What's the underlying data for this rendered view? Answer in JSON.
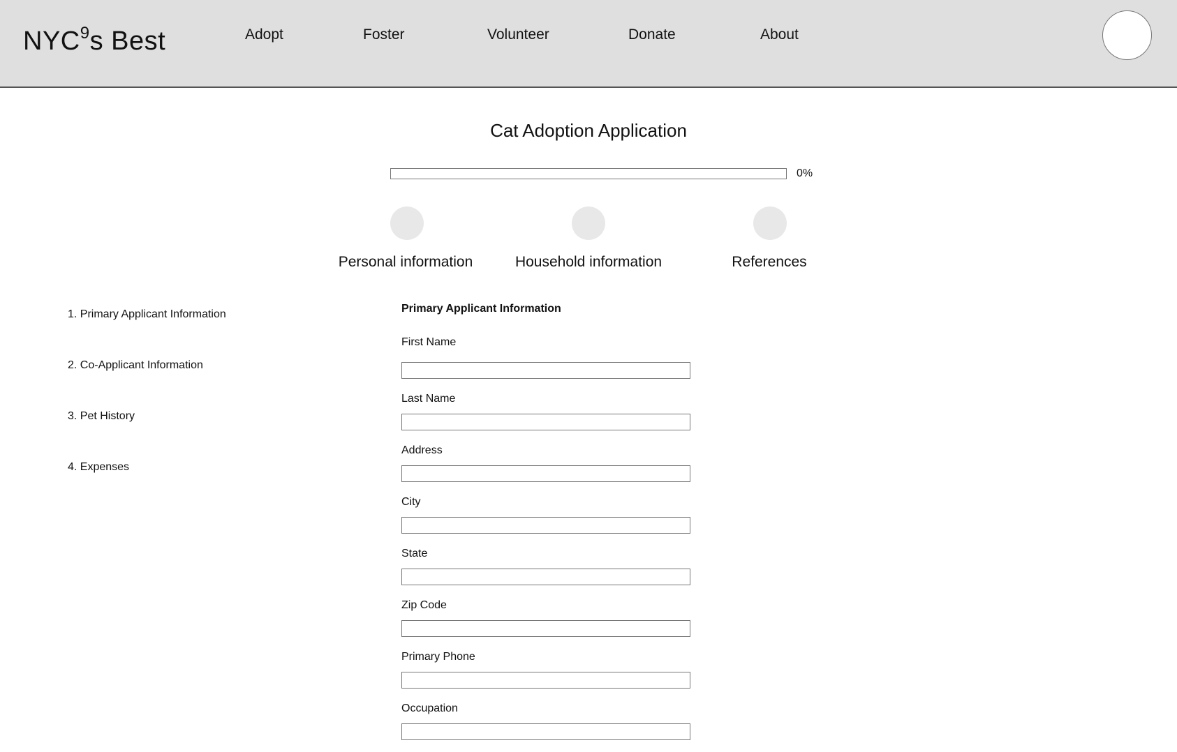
{
  "header": {
    "logo_text": "NYC",
    "logo_apostrophe": "9",
    "logo_suffix": "s Best",
    "nav": [
      "Adopt",
      "Foster",
      "Volunteer",
      "Donate",
      "About"
    ]
  },
  "page": {
    "title": "Cat Adoption Application",
    "progress_percent_label": "0%",
    "progress_value": 0
  },
  "steps": [
    "Personal information",
    "Household information",
    "References"
  ],
  "sidebar": {
    "sections": [
      "1. Primary Applicant Information",
      "2. Co-Applicant Information",
      "3. Pet History",
      "4. Expenses"
    ]
  },
  "form": {
    "heading": "Primary Applicant Information",
    "fields": [
      {
        "label": "First Name",
        "value": ""
      },
      {
        "label": "Last Name",
        "value": ""
      },
      {
        "label": "Address",
        "value": ""
      },
      {
        "label": "City",
        "value": ""
      },
      {
        "label": "State",
        "value": ""
      },
      {
        "label": "Zip Code",
        "value": ""
      },
      {
        "label": "Primary Phone",
        "value": ""
      },
      {
        "label": "Occupation",
        "value": ""
      }
    ]
  }
}
